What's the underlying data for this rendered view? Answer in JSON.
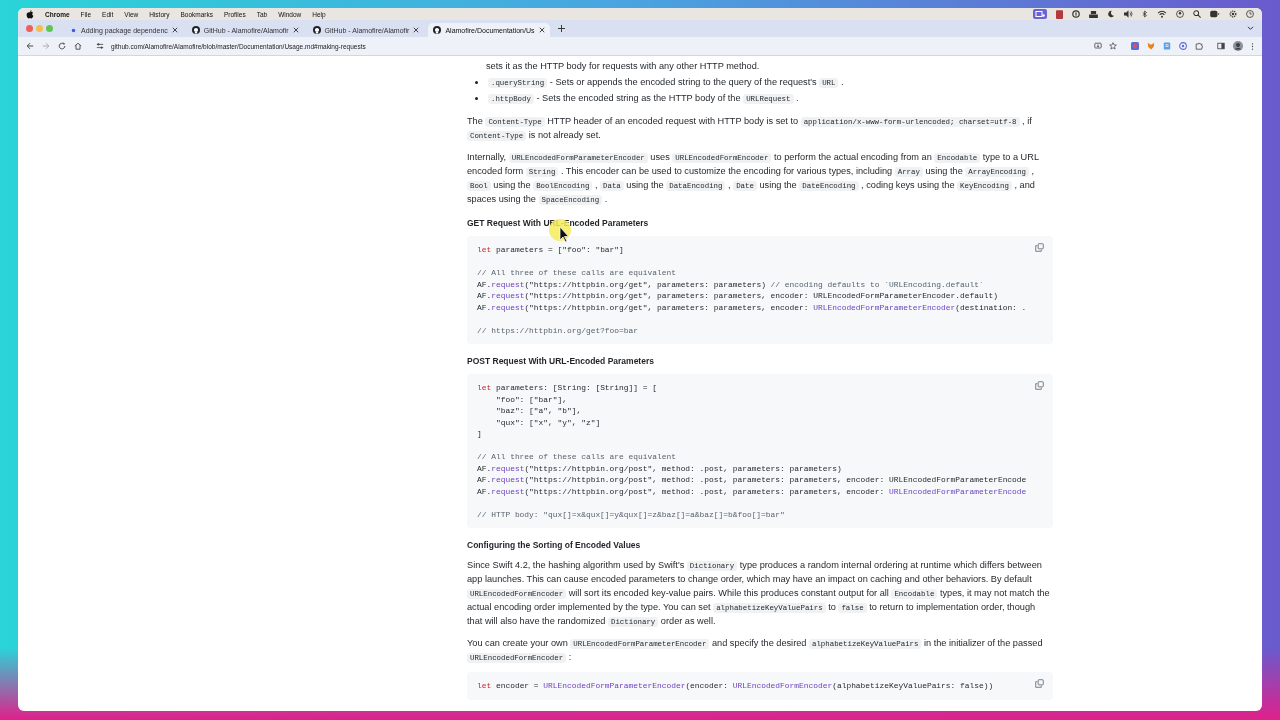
{
  "menu_bar": {
    "items": [
      {
        "label": "Chrome",
        "bold": true
      },
      {
        "label": "File",
        "bold": false
      },
      {
        "label": "Edit",
        "bold": false
      },
      {
        "label": "View",
        "bold": false
      },
      {
        "label": "History",
        "bold": false
      },
      {
        "label": "Bookmarks",
        "bold": false
      },
      {
        "label": "Profiles",
        "bold": false
      },
      {
        "label": "Tab",
        "bold": false
      },
      {
        "label": "Window",
        "bold": false
      },
      {
        "label": "Help",
        "bold": false
      }
    ]
  },
  "tabs": [
    {
      "title": "Adding package dependenc",
      "kind": "dot",
      "selected": false
    },
    {
      "title": "GitHub - Alamofire/Alamofir",
      "kind": "github",
      "selected": false
    },
    {
      "title": "GitHub - Alamofire/Alamofir",
      "kind": "github",
      "selected": false
    },
    {
      "title": "Alamofire/Documentation/Us",
      "kind": "github",
      "selected": true
    }
  ],
  "address_bar": {
    "url": "github.com/Alamofire/Alamofire/blob/master/Documentation/Usage.md#making-requests"
  },
  "content": [
    {
      "kind": "continuation",
      "segments": [
        {
          "kind": "text",
          "text": "sets it as the HTTP body for requests with any other HTTP method."
        }
      ]
    },
    {
      "kind": "bullet",
      "segments": [
        {
          "kind": "code",
          "text": ".queryString"
        },
        {
          "kind": "text",
          "text": " - Sets or appends the encoded string to the query of the request's "
        },
        {
          "kind": "code",
          "text": "URL"
        },
        {
          "kind": "text",
          "text": " ."
        }
      ]
    },
    {
      "kind": "bullet",
      "segments": [
        {
          "kind": "code",
          "text": ".httpBody"
        },
        {
          "kind": "text",
          "text": " - Sets the encoded string as the HTTP body of the "
        },
        {
          "kind": "code",
          "text": "URLRequest"
        },
        {
          "kind": "text",
          "text": " ."
        }
      ]
    },
    {
      "kind": "paragraph",
      "segments": [
        {
          "kind": "text",
          "text": "The "
        },
        {
          "kind": "code",
          "text": "Content-Type"
        },
        {
          "kind": "text",
          "text": " HTTP header of an encoded request with HTTP body is set to "
        },
        {
          "kind": "code",
          "text": "application/x-www-form-urlencoded; charset=utf-8"
        },
        {
          "kind": "text",
          "text": " , if "
        },
        {
          "kind": "code",
          "text": "Content-Type"
        },
        {
          "kind": "text",
          "text": " is not already set."
        }
      ]
    },
    {
      "kind": "paragraph",
      "segments": [
        {
          "kind": "text",
          "text": "Internally, "
        },
        {
          "kind": "code",
          "text": "URLEncodedFormParameterEncoder"
        },
        {
          "kind": "text",
          "text": " uses "
        },
        {
          "kind": "code",
          "text": "URLEncodedFormEncoder"
        },
        {
          "kind": "text",
          "text": " to perform the actual encoding from an "
        },
        {
          "kind": "code",
          "text": "Encodable"
        },
        {
          "kind": "text",
          "text": " type to a URL encoded form "
        },
        {
          "kind": "code",
          "text": "String"
        },
        {
          "kind": "text",
          "text": " . This encoder can be used to customize the encoding for various types, including "
        },
        {
          "kind": "code",
          "text": "Array"
        },
        {
          "kind": "text",
          "text": " using the "
        },
        {
          "kind": "code",
          "text": "ArrayEncoding"
        },
        {
          "kind": "text",
          "text": " , "
        },
        {
          "kind": "code",
          "text": "Bool"
        },
        {
          "kind": "text",
          "text": " using the "
        },
        {
          "kind": "code",
          "text": "BoolEncoding"
        },
        {
          "kind": "text",
          "text": " , "
        },
        {
          "kind": "code",
          "text": "Data"
        },
        {
          "kind": "text",
          "text": " using the "
        },
        {
          "kind": "code",
          "text": "DataEncoding"
        },
        {
          "kind": "text",
          "text": " , "
        },
        {
          "kind": "code",
          "text": "Date"
        },
        {
          "kind": "text",
          "text": " using the "
        },
        {
          "kind": "code",
          "text": "DateEncoding"
        },
        {
          "kind": "text",
          "text": " , coding keys using the "
        },
        {
          "kind": "code",
          "text": "KeyEncoding"
        },
        {
          "kind": "text",
          "text": " , and spaces using the "
        },
        {
          "kind": "code",
          "text": "SpaceEncoding"
        },
        {
          "kind": "text",
          "text": " ."
        }
      ]
    },
    {
      "kind": "heading",
      "text": "GET Request With URL-Encoded Parameters"
    },
    {
      "kind": "code",
      "groups": [
        {
          "lines": [
            [
              {
                "kind": "kw",
                "text": "let"
              },
              {
                "kind": "plain",
                "text": " parameters = [\"foo\": \"bar\"]"
              }
            ]
          ]
        },
        {
          "lines": [
            [
              {
                "kind": "comment",
                "text": "// All three of these calls are equivalent"
              }
            ],
            [
              {
                "kind": "plain",
                "text": "AF."
              },
              {
                "kind": "fn",
                "text": "request"
              },
              {
                "kind": "plain",
                "text": "(\"https://httpbin.org/get\", parameters: parameters) "
              },
              {
                "kind": "comment",
                "text": "// encoding defaults to `URLEncoding.default`"
              }
            ],
            [
              {
                "kind": "plain",
                "text": "AF."
              },
              {
                "kind": "fn",
                "text": "request"
              },
              {
                "kind": "plain",
                "text": "(\"https://httpbin.org/get\", parameters: parameters, encoder: URLEncodedFormParameterEncoder.default)"
              }
            ],
            [
              {
                "kind": "plain",
                "text": "AF."
              },
              {
                "kind": "fn",
                "text": "request"
              },
              {
                "kind": "plain",
                "text": "(\"https://httpbin.org/get\", parameters: parameters, encoder: "
              },
              {
                "kind": "type",
                "text": "URLEncodedFormParameterEncoder"
              },
              {
                "kind": "plain",
                "text": "(destination: ."
              }
            ]
          ]
        },
        {
          "lines": [
            [
              {
                "kind": "comment",
                "text": "// https://httpbin.org/get?foo=bar"
              }
            ]
          ]
        }
      ]
    },
    {
      "kind": "heading",
      "text": "POST Request With URL-Encoded Parameters"
    },
    {
      "kind": "code",
      "groups": [
        {
          "lines": [
            [
              {
                "kind": "kw",
                "text": "let"
              },
              {
                "kind": "plain",
                "text": " parameters: [String: [String]] = ["
              }
            ],
            [
              {
                "kind": "plain",
                "text": "    \"foo\": [\"bar\"],"
              }
            ],
            [
              {
                "kind": "plain",
                "text": "    \"baz\": [\"a\", \"b\"],"
              }
            ],
            [
              {
                "kind": "plain",
                "text": "    \"qux\": [\"x\", \"y\", \"z\"]"
              }
            ],
            [
              {
                "kind": "plain",
                "text": "]"
              }
            ]
          ]
        },
        {
          "lines": [
            [
              {
                "kind": "comment",
                "text": "// All three of these calls are equivalent"
              }
            ],
            [
              {
                "kind": "plain",
                "text": "AF."
              },
              {
                "kind": "fn",
                "text": "request"
              },
              {
                "kind": "plain",
                "text": "(\"https://httpbin.org/post\", method: .post, parameters: parameters)"
              }
            ],
            [
              {
                "kind": "plain",
                "text": "AF."
              },
              {
                "kind": "fn",
                "text": "request"
              },
              {
                "kind": "plain",
                "text": "(\"https://httpbin.org/post\", method: .post, parameters: parameters, encoder: URLEncodedFormParameterEncode"
              }
            ],
            [
              {
                "kind": "plain",
                "text": "AF."
              },
              {
                "kind": "fn",
                "text": "request"
              },
              {
                "kind": "plain",
                "text": "(\"https://httpbin.org/post\", method: .post, parameters: parameters, encoder: "
              },
              {
                "kind": "type",
                "text": "URLEncodedFormParameterEncode"
              }
            ]
          ]
        },
        {
          "lines": [
            [
              {
                "kind": "comment",
                "text": "// HTTP body: \"qux[]=x&qux[]=y&qux[]=z&baz[]=a&baz[]=b&foo[]=bar\""
              }
            ]
          ]
        }
      ]
    },
    {
      "kind": "heading",
      "text": "Configuring the Sorting of Encoded Values"
    },
    {
      "kind": "paragraph",
      "segments": [
        {
          "kind": "text",
          "text": "Since Swift 4.2, the hashing algorithm used by Swift's "
        },
        {
          "kind": "code",
          "text": "Dictionary"
        },
        {
          "kind": "text",
          "text": " type produces a random internal ordering at runtime which differs between app launches. This can cause encoded parameters to change order, which may have an impact on caching and other behaviors. By default "
        },
        {
          "kind": "code",
          "text": "URLEncodedFormEncoder"
        },
        {
          "kind": "text",
          "text": " will sort its encoded key-value pairs. While this produces constant output for all "
        },
        {
          "kind": "code",
          "text": "Encodable"
        },
        {
          "kind": "text",
          "text": " types, it may not match the actual encoding order implemented by the type. You can set "
        },
        {
          "kind": "code",
          "text": "alphabetizeKeyValuePairs"
        },
        {
          "kind": "text",
          "text": " to "
        },
        {
          "kind": "code",
          "text": "false"
        },
        {
          "kind": "text",
          "text": " to return to implementation order, though that will also have the randomized "
        },
        {
          "kind": "code",
          "text": "Dictionary"
        },
        {
          "kind": "text",
          "text": " order as well."
        }
      ]
    },
    {
      "kind": "paragraph",
      "segments": [
        {
          "kind": "text",
          "text": "You can create your own "
        },
        {
          "kind": "code",
          "text": "URLEncodedFormParameterEncoder"
        },
        {
          "kind": "text",
          "text": " and specify the desired "
        },
        {
          "kind": "code",
          "text": "alphabetizeKeyValuePairs"
        },
        {
          "kind": "text",
          "text": " in the initializer of the passed "
        },
        {
          "kind": "code",
          "text": "URLEncodedFormEncoder"
        },
        {
          "kind": "text",
          "text": " :"
        }
      ]
    },
    {
      "kind": "code",
      "groups": [
        {
          "lines": [
            [
              {
                "kind": "kw",
                "text": "let"
              },
              {
                "kind": "plain",
                "text": " encoder = "
              },
              {
                "kind": "type",
                "text": "URLEncodedFormParameterEncoder"
              },
              {
                "kind": "plain",
                "text": "(encoder: "
              },
              {
                "kind": "type",
                "text": "URLEncodedFormEncoder"
              },
              {
                "kind": "plain",
                "text": "(alphabetizeKeyValuePairs: false))"
              }
            ]
          ]
        }
      ]
    }
  ]
}
